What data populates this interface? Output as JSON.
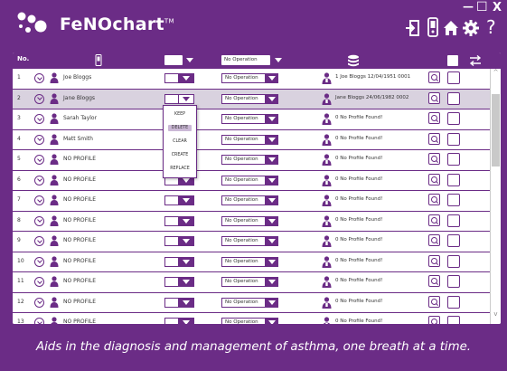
{
  "app": {
    "logo_text": "FeNOchart",
    "logo_tm": "TM"
  },
  "window_controls": {
    "minimize": "—",
    "maximize": "☐",
    "close": "X"
  },
  "header_icons": [
    "logout-icon",
    "device-icon",
    "home-icon",
    "gear-icon",
    "help-icon"
  ],
  "help_glyph": "?",
  "table": {
    "header_no": "No.",
    "header_operation": "No Operation",
    "rows": [
      {
        "no": "1",
        "name": "Joe Bloggs",
        "operation": "No Operation",
        "profile": "1 Joe Bloggs 12/04/1951 0001",
        "selected": false
      },
      {
        "no": "2",
        "name": "Jane Bloggs",
        "operation": "No Operation",
        "profile": "Jane Bloggs 24/06/1982 0002",
        "selected": true
      },
      {
        "no": "3",
        "name": "Sarah Taylor",
        "operation": "No Operation",
        "profile": "0 No Profile Found!",
        "selected": false
      },
      {
        "no": "4",
        "name": "Matt Smith",
        "operation": "No Operation",
        "profile": "0 No Profile Found!",
        "selected": false
      },
      {
        "no": "5",
        "name": "NO PROFILE",
        "operation": "No Operation",
        "profile": "0 No Profile Found!",
        "selected": false
      },
      {
        "no": "6",
        "name": "NO PROFILE",
        "operation": "No Operation",
        "profile": "0 No Profile Found!",
        "selected": false
      },
      {
        "no": "7",
        "name": "NO PROFILE",
        "operation": "No Operation",
        "profile": "0 No Profile Found!",
        "selected": false
      },
      {
        "no": "8",
        "name": "NO PROFILE",
        "operation": "No Operation",
        "profile": "0 No Profile Found!",
        "selected": false
      },
      {
        "no": "9",
        "name": "NO PROFILE",
        "operation": "No Operation",
        "profile": "0 No Profile Found!",
        "selected": false
      },
      {
        "no": "10",
        "name": "NO PROFILE",
        "operation": "No Operation",
        "profile": "0 No Profile Found!",
        "selected": false
      },
      {
        "no": "11",
        "name": "NO PROFILE",
        "operation": "No Operation",
        "profile": "0 No Profile Found!",
        "selected": false
      },
      {
        "no": "12",
        "name": "NO PROFILE",
        "operation": "No Operation",
        "profile": "0 No Profile Found!",
        "selected": false
      },
      {
        "no": "13",
        "name": "NO PROFILE",
        "operation": "No Operation",
        "profile": "0 No Profile Found!",
        "selected": false
      }
    ]
  },
  "dropdown": {
    "items": [
      "KEEP",
      "DELETE",
      "CLEAR",
      "CREATE",
      "REPLACE"
    ],
    "active_index": 1
  },
  "footer": {
    "tagline": "Aids in the diagnosis and management of asthma, one breath at a time."
  },
  "colors": {
    "brand_purple": "#6b2c86",
    "selected_row": "#d9d2df",
    "white": "#ffffff"
  }
}
